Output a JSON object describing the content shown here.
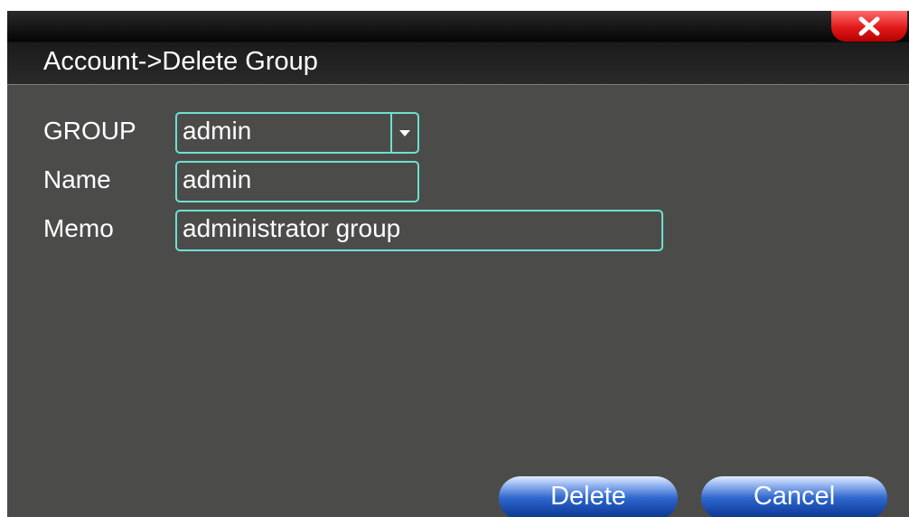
{
  "window": {
    "title": "Account->Delete Group",
    "close_icon": "close-icon"
  },
  "form": {
    "group": {
      "label": "GROUP",
      "value": "admin"
    },
    "name": {
      "label": "Name",
      "value": "admin"
    },
    "memo": {
      "label": "Memo",
      "value": "administrator group"
    }
  },
  "buttons": {
    "delete": "Delete",
    "cancel": "Cancel"
  },
  "colors": {
    "background": "#4b4c4a",
    "field_border": "#6ee0cf",
    "button_blue": "#2f67cc",
    "close_red": "#e01a1a"
  }
}
